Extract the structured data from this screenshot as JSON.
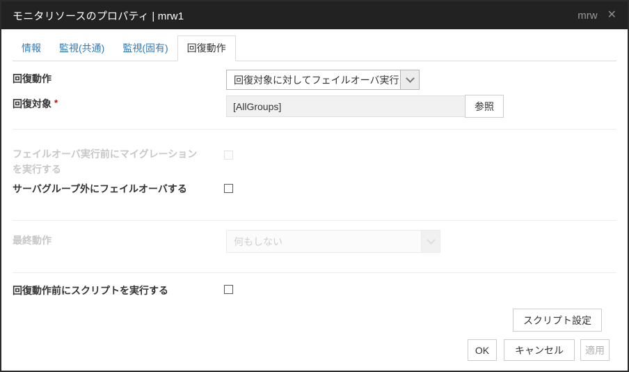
{
  "window": {
    "title": "モニタリソースのプロパティ | mrw1",
    "badge": "mrw",
    "close_icon": "✕"
  },
  "tabs": [
    {
      "label": "情報",
      "active": false
    },
    {
      "label": "監視(共通)",
      "active": false
    },
    {
      "label": "監視(固有)",
      "active": false
    },
    {
      "label": "回復動作",
      "active": true
    }
  ],
  "form": {
    "recovery_action": {
      "label": "回復動作",
      "selected": "回復対象に対してフェイルオーバ実行"
    },
    "recovery_target": {
      "label": "回復対象",
      "required_mark": "*",
      "value": "[AllGroups]",
      "browse_button": "参照"
    },
    "migration_before_failover": {
      "label": "フェイルオーバ実行前にマイグレーションを実行する",
      "checked": false,
      "disabled": true
    },
    "failover_outside_server_group": {
      "label": "サーバグループ外にフェイルオーバする",
      "checked": false,
      "disabled": false
    },
    "final_action": {
      "label": "最終動作",
      "selected": "何もしない",
      "disabled": true
    },
    "script_before_recovery": {
      "label": "回復動作前にスクリプトを実行する",
      "checked": false,
      "disabled": false
    }
  },
  "buttons": {
    "script_settings": "スクリプト設定",
    "ok": "OK",
    "cancel": "キャンセル",
    "apply": "適用",
    "apply_disabled": true
  },
  "colors": {
    "titlebar_bg": "#222222",
    "tab_link": "#337ab7",
    "active_tab_text": "#333333",
    "required_mark": "#cc0000",
    "disabled_text": "#c7c7c7",
    "dialog_border": "#2b2b2b",
    "readonly_field_bg": "#f1f1f1"
  }
}
